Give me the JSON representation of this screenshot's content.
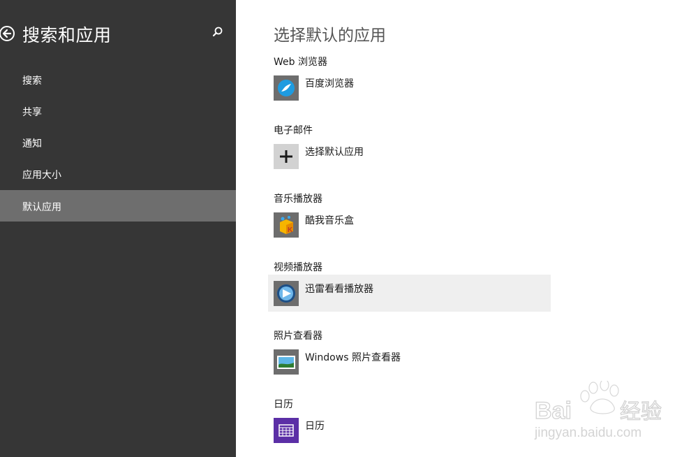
{
  "sidebar": {
    "title": "搜索和应用",
    "back_icon": "back-arrow-icon",
    "search_icon": "search-icon",
    "items": [
      {
        "label": "搜索",
        "active": false
      },
      {
        "label": "共享",
        "active": false
      },
      {
        "label": "通知",
        "active": false
      },
      {
        "label": "应用大小",
        "active": false
      },
      {
        "label": "默认应用",
        "active": true
      }
    ]
  },
  "main": {
    "title": "选择默认的应用",
    "sections": [
      {
        "label": "Web 浏览器",
        "app": "百度浏览器",
        "icon": "baidu-browser-icon"
      },
      {
        "label": "电子邮件",
        "app": "选择默认应用",
        "icon": "plus-icon"
      },
      {
        "label": "音乐播放器",
        "app": "酷我音乐盒",
        "icon": "kuwo-music-icon"
      },
      {
        "label": "视频播放器",
        "app": "迅雷看看播放器",
        "icon": "xunlei-player-icon"
      },
      {
        "label": "照片查看器",
        "app": "Windows 照片查看器",
        "icon": "photo-viewer-icon"
      },
      {
        "label": "日历",
        "app": "日历",
        "icon": "calendar-icon"
      }
    ]
  },
  "watermark": {
    "brand": "Baidu经验",
    "url": "jingyan.baidu.com"
  },
  "colors": {
    "sidebar_bg": "#363636",
    "sidebar_active": "#6e6e6e",
    "hover_row": "#efefef",
    "calendar_purple": "#5b2fa6"
  }
}
